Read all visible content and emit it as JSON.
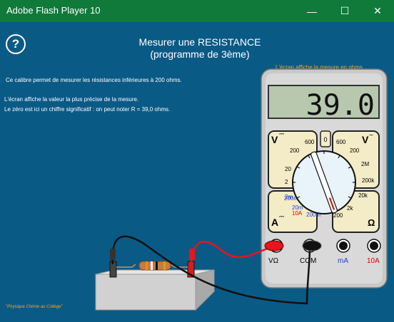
{
  "window": {
    "title": "Adobe Flash Player 10",
    "controls": {
      "minimize": "—",
      "maximize": "☐",
      "close": "✕"
    }
  },
  "header": {
    "help": "?",
    "title_line1": "Mesurer une RESISTANCE",
    "title_line2": "(programme de 3ème)"
  },
  "note": "L'écran affiche la mesure en ohms",
  "explanation": {
    "line1": "Ce calibre permet de mesurer les résistances inférieures à 200 ohms.",
    "line2": "L'écran affiche la valeur la plus précise de la mesure.",
    "line3": "Le zéro est ici un chiffre significatif : on peut noter R = 39,0 ohms."
  },
  "multimeter": {
    "display": "39.0",
    "selected_range": "200 Ω",
    "scales": {
      "vdc_label": "V",
      "vdc": [
        "600",
        "200",
        "20",
        "2",
        "200m"
      ],
      "vac_label": "V",
      "vac": [
        "600",
        "200"
      ],
      "ohm_label": "Ω",
      "ohm": [
        "2M",
        "200k",
        "20k",
        "2k",
        "200"
      ],
      "adc_label": "A",
      "adc": [
        "2m",
        "20m",
        "10A",
        "200m"
      ],
      "off": "0"
    },
    "jacks": {
      "v_ohm": "VΩ",
      "com": "COM",
      "ma": "mA",
      "a10": "10A"
    }
  },
  "colors": {
    "background": "#0a5a86",
    "titlebar": "#0f7a3a",
    "meter_body": "#e8e0b2",
    "accent": "#f5a623",
    "red_lead": "#e8141e"
  },
  "footer": "\"Physique Chimie au Collège\""
}
